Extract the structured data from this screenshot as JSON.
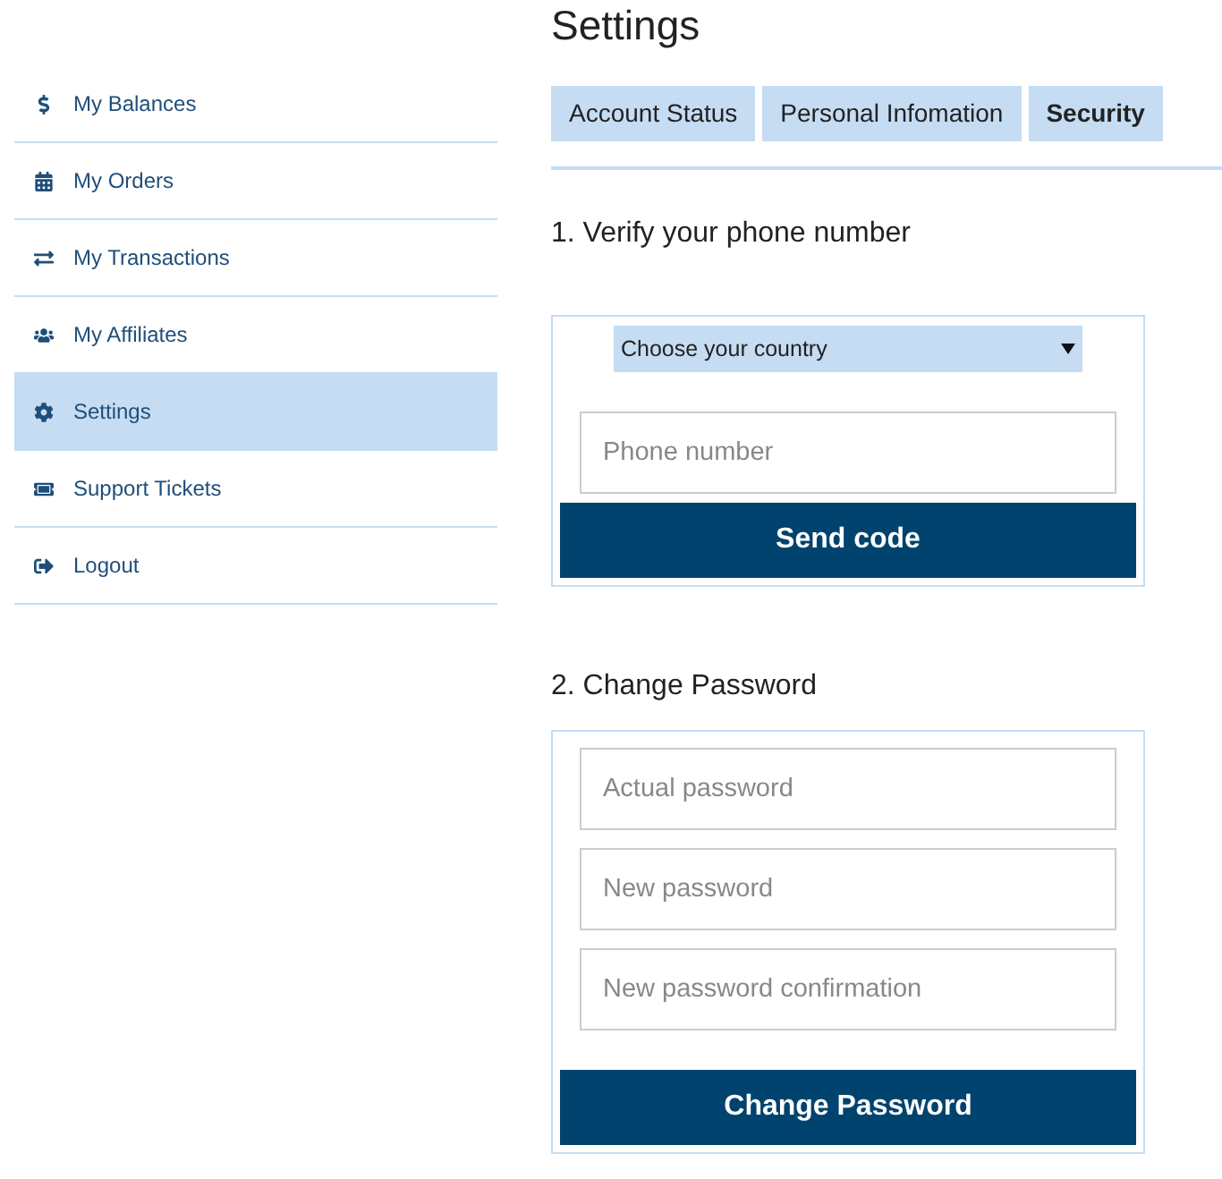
{
  "sidebar": {
    "items": [
      {
        "label": "My Balances",
        "kind": "dollar",
        "selected": false
      },
      {
        "label": "My Orders",
        "kind": "calendar",
        "selected": false
      },
      {
        "label": "My Transactions",
        "kind": "exchange",
        "selected": false
      },
      {
        "label": "My Affiliates",
        "kind": "users",
        "selected": false
      },
      {
        "label": "Settings",
        "kind": "cog",
        "selected": true
      },
      {
        "label": "Support Tickets",
        "kind": "ticket",
        "selected": false
      },
      {
        "label": "Logout",
        "kind": "logout",
        "selected": false
      }
    ]
  },
  "page": {
    "title": "Settings"
  },
  "tabs": [
    {
      "label": "Account Status",
      "selected": false
    },
    {
      "label": "Personal Infomation",
      "selected": false
    },
    {
      "label": "Security",
      "selected": true
    }
  ],
  "phone_section": {
    "heading": "1. Verify your phone number",
    "country_select": {
      "value": "Choose your country"
    },
    "phone_field": {
      "placeholder": "Phone number"
    },
    "button": "Send code"
  },
  "password_section": {
    "heading": "2. Change Password",
    "fields": [
      {
        "placeholder": "Actual password"
      },
      {
        "placeholder": "New password"
      },
      {
        "placeholder": "New password confirmation"
      }
    ],
    "button": "Change Password"
  }
}
